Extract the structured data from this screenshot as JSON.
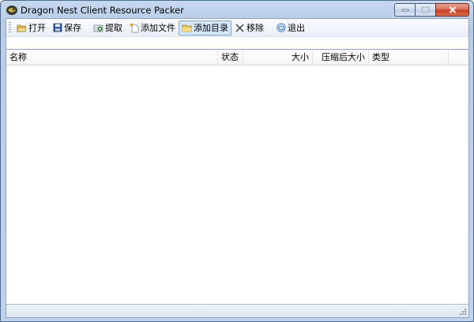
{
  "window": {
    "title": "Dragon Nest Client Resource Packer",
    "icon": "dragon-app-icon"
  },
  "toolbar": {
    "items": [
      {
        "label": "打开",
        "icon": "open-folder-icon"
      },
      {
        "label": "保存",
        "icon": "save-disk-icon"
      },
      {
        "label": "提取",
        "icon": "extract-icon"
      },
      {
        "label": "添加文件",
        "icon": "add-file-icon"
      },
      {
        "label": "添加目录",
        "icon": "add-folder-icon",
        "active": true
      },
      {
        "label": "移除",
        "icon": "remove-x-icon"
      },
      {
        "label": "退出",
        "icon": "power-exit-icon"
      }
    ]
  },
  "listview": {
    "columns": [
      "名称",
      "状态",
      "大小",
      "压缩后大小",
      "类型"
    ],
    "rows": []
  },
  "colors": {
    "frame": "#b9cde8",
    "close_button": "#c2391e",
    "active_button": "#d6e8fb"
  }
}
